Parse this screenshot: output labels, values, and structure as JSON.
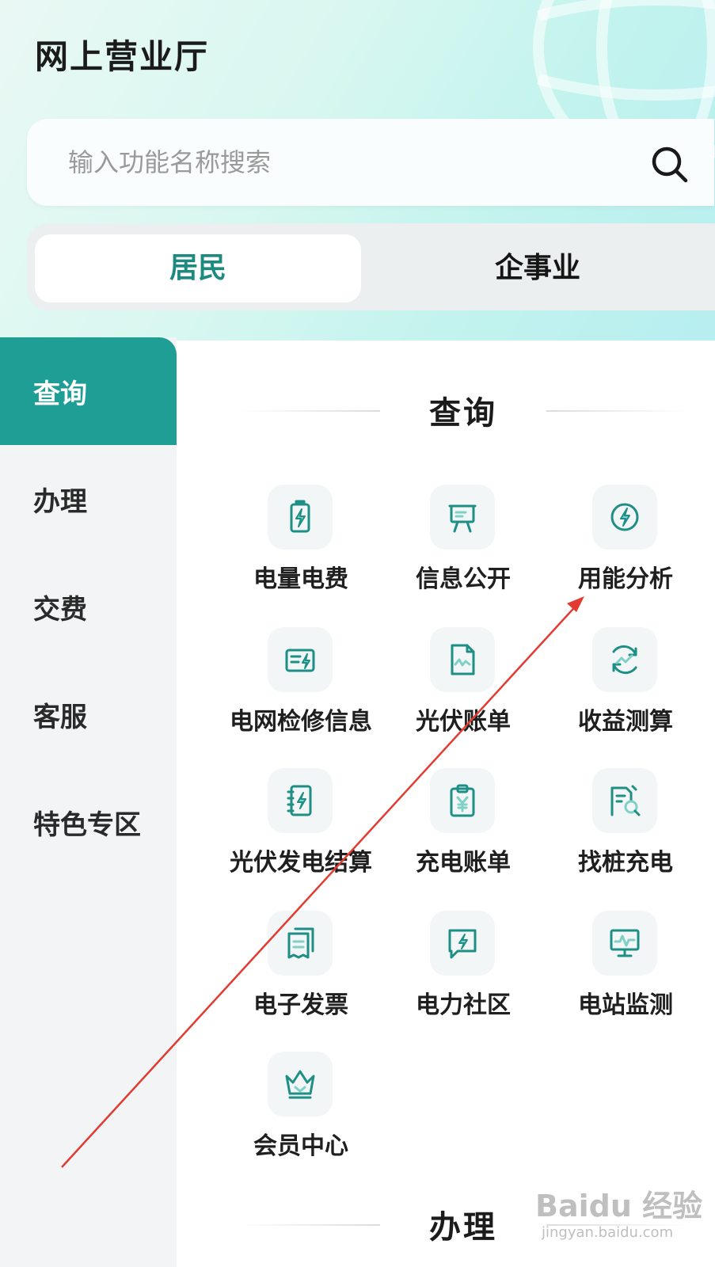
{
  "header": {
    "title": "网上营业厅"
  },
  "search": {
    "placeholder": "输入功能名称搜索"
  },
  "segment": {
    "tabs": [
      "居民",
      "企事业"
    ],
    "active": "居民"
  },
  "sidebar": {
    "items": [
      "查询",
      "办理",
      "交费",
      "客服",
      "特色专区"
    ],
    "active": "查询"
  },
  "sections": [
    {
      "title": "查询",
      "items": [
        {
          "label": "电量电费",
          "icon": "battery-bolt-icon"
        },
        {
          "label": "信息公开",
          "icon": "easel-board-icon"
        },
        {
          "label": "用能分析",
          "icon": "energy-gauge-icon"
        },
        {
          "label": "电网检修信息",
          "icon": "repair-card-icon"
        },
        {
          "label": "光伏账单",
          "icon": "solar-bill-icon"
        },
        {
          "label": "收益测算",
          "icon": "profit-calc-icon"
        },
        {
          "label": "光伏发电结算",
          "icon": "notebook-bolt-icon"
        },
        {
          "label": "充电账单",
          "icon": "clipboard-yuan-icon"
        },
        {
          "label": "找桩充电",
          "icon": "find-pile-icon"
        },
        {
          "label": "电子发票",
          "icon": "invoice-icon"
        },
        {
          "label": "电力社区",
          "icon": "chat-bolt-icon"
        },
        {
          "label": "电站监测",
          "icon": "monitor-chart-icon"
        },
        {
          "label": "会员中心",
          "icon": "crown-icon"
        }
      ]
    },
    {
      "title": "办理"
    }
  ],
  "watermark": {
    "main": "Baidu 经验",
    "sub": "jingyan.baidu.com"
  },
  "colors": {
    "accent": "#1f9e95",
    "active_tab_text": "#1d8a80",
    "icon_stroke": "#1e8f86",
    "annotation_arrow": "#e23b32"
  }
}
